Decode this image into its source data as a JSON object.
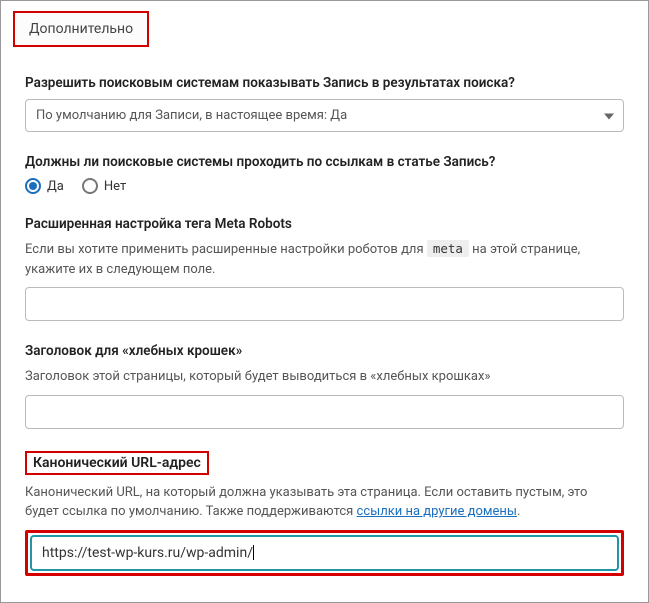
{
  "tab": {
    "title": "Дополнительно"
  },
  "allow_search": {
    "label": "Разрешить поисковым системам показывать Запись в результатах поиска?",
    "selected": "По умолчанию для Записи, в настоящее время: Да"
  },
  "follow_links": {
    "label": "Должны ли поисковые системы проходить по ссылкам в статье Запись?",
    "yes": "Да",
    "no": "Нет"
  },
  "meta_robots": {
    "label": "Расширенная настройка тега Meta Robots",
    "helper_before": "Если вы хотите применить расширенные настройки роботов для ",
    "code": "meta",
    "helper_after": " на этой странице, укажите их в следующем поле.",
    "value": ""
  },
  "breadcrumbs": {
    "label": "Заголовок для «хлебных крошек»",
    "helper": "Заголовок этой страницы, который будет выводиться в «хлебных крошках»",
    "value": ""
  },
  "canonical": {
    "label": "Канонический URL-адрес",
    "helper_before": "Канонический URL, на который должна указывать эта страница. Если оставить пустым, это будет ссылка по умолчанию. Также поддерживаются ",
    "link_text": "ссылки на другие домены",
    "helper_after": ".",
    "value": "https://test-wp-kurs.ru/wp-admin/"
  }
}
